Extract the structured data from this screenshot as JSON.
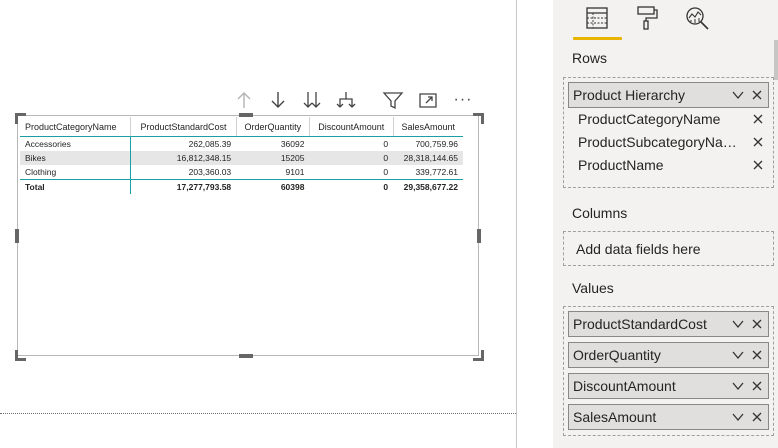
{
  "matrix": {
    "headers": [
      "ProductCategoryName",
      "ProductStandardCost",
      "OrderQuantity",
      "DiscountAmount",
      "SalesAmount"
    ],
    "rows": [
      {
        "category": "Accessories",
        "cost": "262,085.39",
        "qty": "36092",
        "discount": "0",
        "sales": "700,759.96"
      },
      {
        "category": "Bikes",
        "cost": "16,812,348.15",
        "qty": "15205",
        "discount": "0",
        "sales": "28,318,144.65"
      },
      {
        "category": "Clothing",
        "cost": "203,360.03",
        "qty": "9101",
        "discount": "0",
        "sales": "339,772.61"
      }
    ],
    "total": {
      "category": "Total",
      "cost": "17,277,793.58",
      "qty": "60398",
      "discount": "0",
      "sales": "29,358,677.22"
    }
  },
  "visual_header": {
    "icons": [
      "drill-up-icon",
      "drill-down-icon",
      "expand-all-levels-icon",
      "expand-next-level-icon",
      "filter-icon",
      "focus-mode-icon",
      "more-options-icon"
    ],
    "more_label": "···"
  },
  "pane": {
    "tabs": [
      "fields-tab-icon",
      "format-tab-icon",
      "analytics-tab-icon"
    ],
    "rows_label": "Rows",
    "rows_hierarchy": "Product Hierarchy",
    "rows_levels": [
      "ProductCategoryName",
      "ProductSubcategoryNa…",
      "ProductName"
    ],
    "columns_label": "Columns",
    "columns_placeholder": "Add data fields here",
    "values_label": "Values",
    "values_fields": [
      "ProductStandardCost",
      "OrderQuantity",
      "DiscountAmount",
      "SalesAmount"
    ]
  },
  "colors": {
    "accent_underline": "#e8b400",
    "matrix_rule": "#1a9fa5",
    "pane_background": "#f3f2f1"
  }
}
